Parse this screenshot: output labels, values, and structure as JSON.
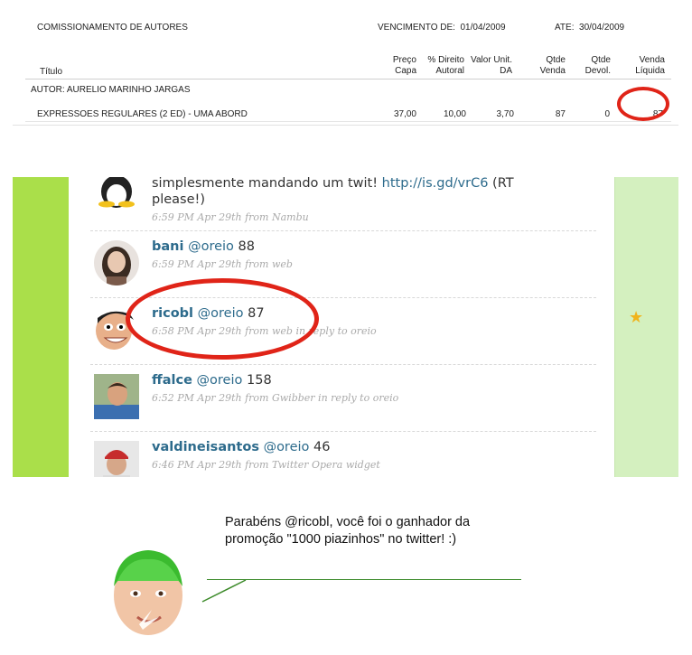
{
  "report": {
    "title": "COMISSIONAMENTO DE AUTORES",
    "vencimento_label": "VENCIMENTO DE:",
    "vencimento_date": "01/04/2009",
    "ate_label": "ATE:",
    "ate_date": "30/04/2009",
    "columns": {
      "titulo": "Título",
      "preco_1": "Preço",
      "preco_2": "Capa",
      "direito_1": "% Direito",
      "direito_2": "Autoral",
      "valor_1": "Valor Unit.",
      "valor_2": "DA",
      "qtde_venda_1": "Qtde",
      "qtde_venda_2": "Venda",
      "qtde_devol_1": "Qtde",
      "qtde_devol_2": "Devol.",
      "venda_liq_1": "Venda",
      "venda_liq_2": "Líquida"
    },
    "autor": "AUTOR: AURELIO MARINHO JARGAS",
    "row": {
      "title": "EXPRESSOES REGULARES (2 ED) - UMA ABORD",
      "preco": "37,00",
      "direito": "10,00",
      "valor": "3,70",
      "qtde_venda": "87",
      "qtde_devol": "0",
      "venda_liquida": "87"
    }
  },
  "twitter": {
    "tweets": [
      {
        "text_before": "simplesmente mandando um twit! ",
        "link": "http://is.gd/vrC6",
        "text_after": " (RT please!)",
        "meta": "6:59 PM Apr 29th from Nambu"
      },
      {
        "user": "bani",
        "mention": "@oreio",
        "text": " 88",
        "meta": "6:59 PM Apr 29th from web"
      },
      {
        "user": "ricobl",
        "mention": "@oreio",
        "text": " 87",
        "meta": "6:58 PM Apr 29th from web in reply to oreio"
      },
      {
        "user": "ffalce",
        "mention": "@oreio",
        "text": " 158",
        "meta": "6:52 PM Apr 29th from Gwibber in reply to oreio"
      },
      {
        "user": "valdineisantos",
        "mention": "@oreio",
        "text": " 46",
        "meta": "6:46 PM Apr 29th from Twitter Opera widget"
      }
    ]
  },
  "speech": {
    "text": "Parabéns @ricobl, você foi o ganhador da promoção \"1000 piazinhos\" no twitter! :)"
  },
  "colors": {
    "highlight": "#e02418",
    "twitter_green": "#aadf4a",
    "link_blue": "#2d6b8c"
  }
}
